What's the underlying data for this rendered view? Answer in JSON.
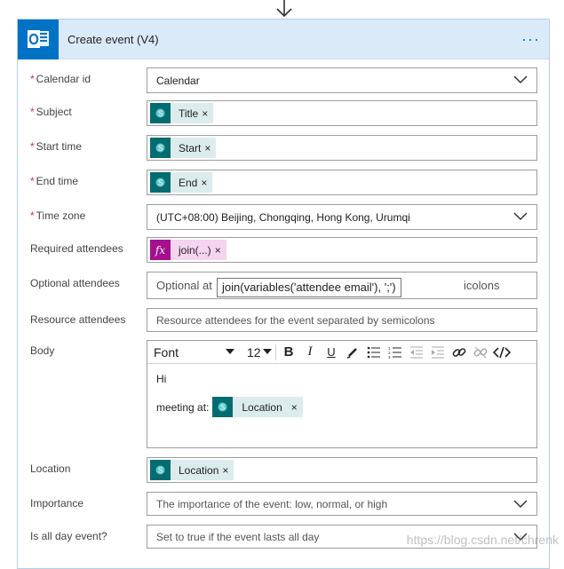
{
  "card": {
    "title": "Create event (V4)",
    "more": "···",
    "logo_icon": "outlook-icon"
  },
  "fields": {
    "calendar_id": {
      "label": "Calendar id",
      "required": true,
      "value": "Calendar"
    },
    "subject": {
      "label": "Subject",
      "required": true,
      "token": "Title"
    },
    "start_time": {
      "label": "Start time",
      "required": true,
      "token": "Start"
    },
    "end_time": {
      "label": "End time",
      "required": true,
      "token": "End"
    },
    "time_zone": {
      "label": "Time zone",
      "required": true,
      "value": "(UTC+08:00) Beijing, Chongqing, Hong Kong, Urumqi"
    },
    "required_attendees": {
      "label": "Required attendees",
      "token": "join(...)"
    },
    "optional_attendees": {
      "label": "Optional attendees",
      "placeholder_start": "Optional at",
      "placeholder_end": "icolons"
    },
    "resource_attendees": {
      "label": "Resource attendees",
      "placeholder": "Resource attendees for the event separated by semicolons"
    },
    "body": {
      "label": "Body",
      "toolbar": {
        "font": "Font",
        "size": "12",
        "bold": "B",
        "italic": "I",
        "underline": "U"
      },
      "line1": "Hi",
      "line2": "meeting at:",
      "token": "Location"
    },
    "location": {
      "label": "Location",
      "token": "Location"
    },
    "importance": {
      "label": "Importance",
      "placeholder": "The importance of the event: low, normal, or high"
    },
    "all_day": {
      "label": "Is all day event?",
      "placeholder": "Set to true if the event lasts all day"
    }
  },
  "tooltip": "join(variables('attendee email'), ';')",
  "token_remove": "×",
  "required_mark": "*",
  "fx_glyph": "fx",
  "watermark": "https://blog.csdn.net/chrenk",
  "colors": {
    "header_bg": "#dbeaf8",
    "outlook_blue": "#0072c6",
    "sharepoint_teal": "#036c70",
    "expression_purple": "#a4108d",
    "required_red": "#d13438"
  }
}
